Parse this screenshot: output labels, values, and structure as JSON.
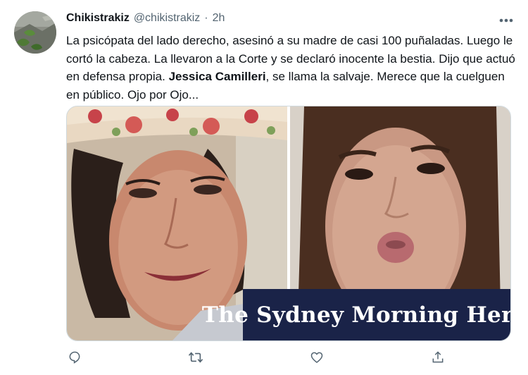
{
  "user": {
    "display_name": "Chikistrakiz",
    "handle": "@chikistrakiz",
    "separator": "·",
    "timestamp": "2h"
  },
  "tweet": {
    "text_part1": "La psicópata del lado derecho, asesinó a su madre de casi 100 puñaladas. Luego le cortó la cabeza. La llevaron a la Corte y se declaró inocente la bestia. Dijo que actuó en defensa propia. ",
    "text_bold": "Jessica Camilleri",
    "text_part2": ", se llama la salvaje. Merece que la cuelguen en público. Ojo por Ojo..."
  },
  "media": {
    "watermark": "The Sydney Morning Herald"
  },
  "icons": {
    "more": "more-horizontal-icon",
    "reply": "reply-icon",
    "retweet": "retweet-icon",
    "like": "like-heart-icon",
    "share": "share-icon"
  },
  "colors": {
    "text_primary": "#0f1419",
    "text_secondary": "#536471",
    "border": "#cfd9de",
    "watermark_bg": "#1a2348"
  }
}
